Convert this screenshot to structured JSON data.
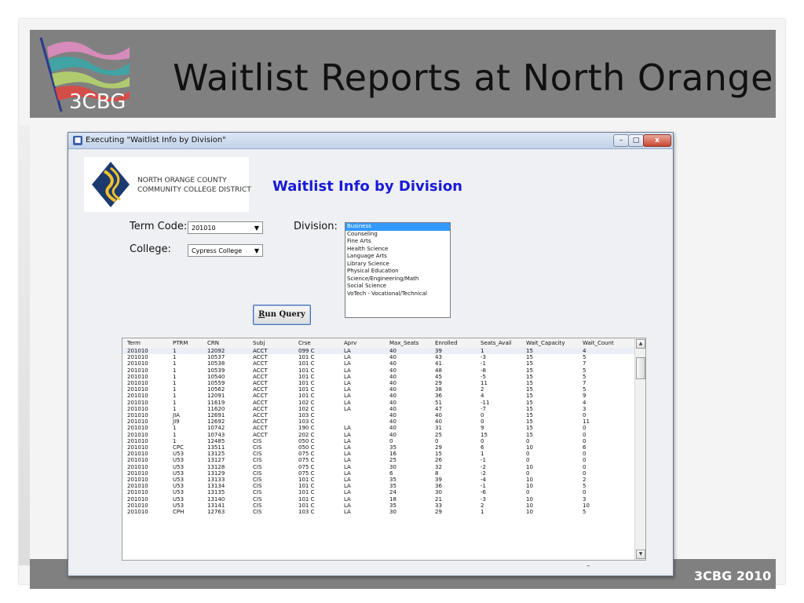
{
  "slide": {
    "title": "Waitlist Reports at North Orange",
    "logo_text": "3CBG",
    "footer": "3CBG 2010"
  },
  "window": {
    "title": "Executing \"Waitlist Info by Division\"",
    "min_glyph": "–",
    "max_glyph": "□",
    "close_glyph": "x"
  },
  "form": {
    "org_line1": "NORTH ORANGE COUNTY",
    "org_line2": "COMMUNITY COLLEGE DISTRICT",
    "title": "Waitlist Info by Division",
    "term_label": "Term Code:",
    "term_value": "201010",
    "college_label": "College:",
    "college_value": "Cypress College",
    "division_label": "Division:",
    "divisions": [
      "Business",
      "Counseling",
      "Fine Arts",
      "Health Science",
      "Language Arts",
      "Library Science",
      "Physical Education",
      "Science/Engineering/Math",
      "Social Science",
      "VoTech - Vocational/Technical"
    ],
    "selected_division": "Business",
    "run_button_prefix": "R",
    "run_button_rest": "un Query"
  },
  "grid": {
    "columns": [
      "Term",
      "PTRM",
      "CRN",
      "Subj",
      "Crse",
      "Aprv",
      "Max_Seats",
      "Enrolled",
      "Seats_Avail",
      "Wait_Capacity",
      "Wait_Count"
    ],
    "rows": [
      [
        "201010",
        "1",
        "12092",
        "ACCT",
        "099 C",
        "LA",
        "40",
        "39",
        "1",
        "15",
        "4"
      ],
      [
        "201010",
        "1",
        "10537",
        "ACCT",
        "101 C",
        "LA",
        "40",
        "43",
        "-3",
        "15",
        "5"
      ],
      [
        "201010",
        "1",
        "10538",
        "ACCT",
        "101 C",
        "LA",
        "40",
        "41",
        "-1",
        "15",
        "7"
      ],
      [
        "201010",
        "1",
        "10539",
        "ACCT",
        "101 C",
        "LA",
        "40",
        "48",
        "-8",
        "15",
        "5"
      ],
      [
        "201010",
        "1",
        "10540",
        "ACCT",
        "101 C",
        "LA",
        "40",
        "45",
        "-5",
        "15",
        "5"
      ],
      [
        "201010",
        "1",
        "10559",
        "ACCT",
        "101 C",
        "LA",
        "40",
        "29",
        "11",
        "15",
        "7"
      ],
      [
        "201010",
        "1",
        "10562",
        "ACCT",
        "101 C",
        "LA",
        "40",
        "38",
        "2",
        "15",
        "5"
      ],
      [
        "201010",
        "1",
        "12091",
        "ACCT",
        "101 C",
        "LA",
        "40",
        "36",
        "4",
        "15",
        "9"
      ],
      [
        "201010",
        "1",
        "11619",
        "ACCT",
        "102 C",
        "LA",
        "40",
        "51",
        "-11",
        "15",
        "4"
      ],
      [
        "201010",
        "1",
        "11620",
        "ACCT",
        "102 C",
        "LA",
        "40",
        "47",
        "-7",
        "15",
        "3"
      ],
      [
        "201010",
        "JIA",
        "12691",
        "ACCT",
        "103 C",
        "",
        "40",
        "40",
        "0",
        "15",
        "0"
      ],
      [
        "201010",
        "JI9",
        "12692",
        "ACCT",
        "103 C",
        "",
        "40",
        "40",
        "0",
        "15",
        "11"
      ],
      [
        "201010",
        "1",
        "10742",
        "ACCT",
        "190 C",
        "LA",
        "40",
        "31",
        "9",
        "15",
        "0"
      ],
      [
        "201010",
        "1",
        "10743",
        "ACCT",
        "202 C",
        "LA",
        "40",
        "25",
        "15",
        "15",
        "0"
      ],
      [
        "201010",
        "1",
        "12485",
        "CIS",
        "050 C",
        "LA",
        "0",
        "0",
        "0",
        "0",
        "0"
      ],
      [
        "201010",
        "CPC",
        "13511",
        "CIS",
        "050 C",
        "LA",
        "35",
        "29",
        "6",
        "10",
        "6"
      ],
      [
        "201010",
        "U53",
        "13125",
        "CIS",
        "075 C",
        "LA",
        "16",
        "15",
        "1",
        "0",
        "0"
      ],
      [
        "201010",
        "U53",
        "13127",
        "CIS",
        "075 C",
        "LA",
        "25",
        "26",
        "-1",
        "0",
        "0"
      ],
      [
        "201010",
        "U53",
        "13128",
        "CIS",
        "075 C",
        "LA",
        "30",
        "32",
        "-2",
        "10",
        "0"
      ],
      [
        "201010",
        "U53",
        "13129",
        "CIS",
        "075 C",
        "LA",
        "6",
        "8",
        "-2",
        "0",
        "0"
      ],
      [
        "201010",
        "U53",
        "13133",
        "CIS",
        "101 C",
        "LA",
        "35",
        "39",
        "-4",
        "10",
        "2"
      ],
      [
        "201010",
        "U53",
        "13134",
        "CIS",
        "101 C",
        "LA",
        "35",
        "36",
        "-1",
        "10",
        "5"
      ],
      [
        "201010",
        "U53",
        "13135",
        "CIS",
        "101 C",
        "LA",
        "24",
        "30",
        "-6",
        "0",
        "0"
      ],
      [
        "201010",
        "U53",
        "13140",
        "CIS",
        "101 C",
        "LA",
        "18",
        "21",
        "-3",
        "10",
        "3"
      ],
      [
        "201010",
        "U53",
        "13141",
        "CIS",
        "101 C",
        "LA",
        "35",
        "33",
        "2",
        "10",
        "10"
      ],
      [
        "201010",
        "CPH",
        "12763",
        "CIS",
        "103 C",
        "LA",
        "30",
        "29",
        "1",
        "10",
        "5"
      ]
    ]
  },
  "colors": {
    "title_blue": "#1a1ad8",
    "selection": "#3399ff",
    "header_gray": "#808080"
  },
  "icons": {
    "logo": "flag-banner-icon",
    "window": "app-window-icon",
    "scroll_up": "chevron-up-icon",
    "scroll_down": "chevron-down-icon",
    "dropdown": "triangle-down-icon"
  }
}
